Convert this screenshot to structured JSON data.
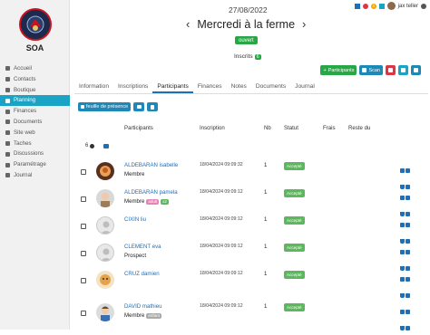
{
  "org": {
    "name": "SOA"
  },
  "nav": [
    {
      "label": "Accueil",
      "icon": "home-icon",
      "active": false
    },
    {
      "label": "Contacts",
      "icon": "contacts-icon",
      "active": false
    },
    {
      "label": "Boutique",
      "icon": "shop-icon",
      "active": false
    },
    {
      "label": "Planning",
      "icon": "calendar-icon",
      "active": true
    },
    {
      "label": "Finances",
      "icon": "finances-icon",
      "active": false
    },
    {
      "label": "Documents",
      "icon": "documents-icon",
      "active": false
    },
    {
      "label": "Site web",
      "icon": "globe-icon",
      "active": false
    },
    {
      "label": "Taches",
      "icon": "tasks-icon",
      "active": false
    },
    {
      "label": "Discussions",
      "icon": "chat-icon",
      "active": false
    },
    {
      "label": "Paramétrage",
      "icon": "gear-icon",
      "active": false
    },
    {
      "label": "Journal",
      "icon": "journal-icon",
      "active": false
    }
  ],
  "topbar": {
    "notif_count": "3",
    "user_name": "jax teller"
  },
  "header": {
    "date": "27/08/2022",
    "title": "Mercredi à la ferme",
    "prev": "‹",
    "next": "›",
    "status": "ouvert",
    "inscrits_label": "Inscrits",
    "inscrits_count": "6"
  },
  "actions": {
    "participants": "Participants",
    "scan": "Scan"
  },
  "tabs": [
    "Information",
    "Inscriptions",
    "Participants",
    "Finances",
    "Notes",
    "Documents",
    "Journal"
  ],
  "active_tab": 2,
  "subbar": {
    "sheet": "feuille de présence"
  },
  "table": {
    "headers": {
      "participants": "Participants",
      "inscription": "Inscription",
      "nb": "Nb",
      "statut": "Statut",
      "frais": "Frais",
      "reste": "Reste du"
    },
    "count": "6",
    "rows": [
      {
        "name": "ALDEBARAN isabelle",
        "role": "Membre",
        "tag": "",
        "date": "18/04/2024 09:09:32",
        "nb": "1",
        "status": "Accepté"
      },
      {
        "name": "ALDEBARAN pamela",
        "role": "Membre",
        "tag": "adult",
        "tag2": "x2",
        "date": "18/04/2024 09:09:12",
        "nb": "1",
        "status": "Accepté"
      },
      {
        "name": "CIXIN liu",
        "role": "",
        "tag": "",
        "date": "18/04/2024 09:09:12",
        "nb": "1",
        "status": "Accepté"
      },
      {
        "name": "CLEMENT eva",
        "role": "Prospect",
        "tag": "",
        "date": "18/04/2024 09:09:12",
        "nb": "1",
        "status": "Accepté"
      },
      {
        "name": "CRUZ damien",
        "role": "",
        "tag": "",
        "date": "18/04/2024 09:09:12",
        "nb": "1",
        "status": "Accepté"
      },
      {
        "name": "DAVID mathieu",
        "role": "Membre",
        "tag": "enfant",
        "date": "18/04/2024 09:09:12",
        "nb": "1",
        "status": "Accepté"
      }
    ]
  },
  "colors": {
    "accent": "#1ba3c6",
    "green": "#28a745",
    "link": "#1e6fb8"
  }
}
